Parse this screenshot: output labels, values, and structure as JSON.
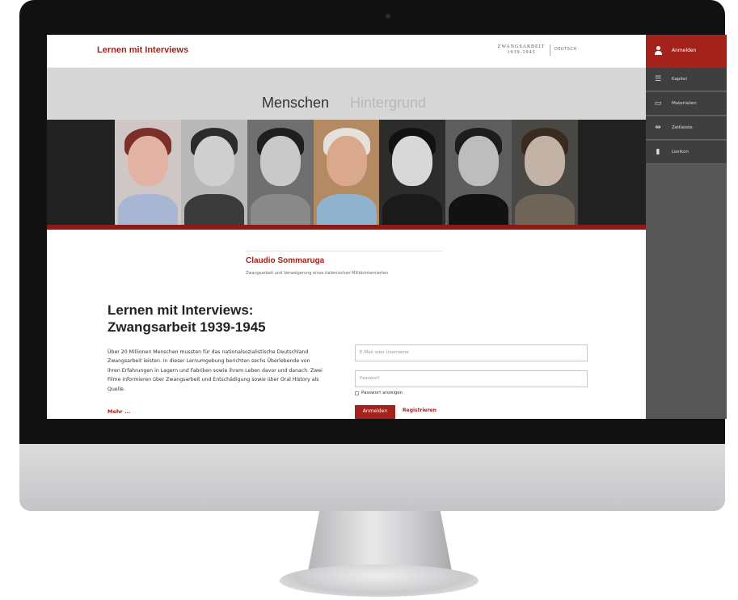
{
  "site": {
    "title": "Lernen mit Interviews",
    "brand": "ZWANGSARBEIT 1939-1945",
    "brand_lang": "DEUTSCH"
  },
  "tabs": [
    {
      "label": "Menschen",
      "active": true
    },
    {
      "label": "Hintergrund",
      "active": false
    }
  ],
  "person": {
    "name": "Claudio Sommaruga",
    "subtitle": "Zwangsarbeit und Verweigerung eines italienischen Militärinternierten"
  },
  "intro": {
    "heading_line1": "Lernen mit Interviews:",
    "heading_line2": "Zwangsarbeit 1939-1945",
    "text": "Über 20 Millionen Menschen mussten für das nationalsozialistische Deutschland Zwangsarbeit leisten. In dieser Lernumgebung berichten sechs Überlebende von ihren Erfahrungen in Lagern und Fabriken sowie ihrem Leben davor und danach. Zwei Filme informieren über Zwangsarbeit und Entschädigung sowie über Oral History als Quelle.",
    "more_link": "Mehr ..."
  },
  "login_form": {
    "email_placeholder": "E-Mail oder Username",
    "password_placeholder": "Passwort",
    "show_password_label": "Passwort anzeigen",
    "login_button": "Anmelden",
    "register_link": "Registrieren"
  },
  "sidebar": {
    "login_label": "Anmelden",
    "items": [
      {
        "label": "Kapitel",
        "icon": "menu-icon"
      },
      {
        "label": "Materialien",
        "icon": "folder-icon"
      },
      {
        "label": "Zeitleiste",
        "icon": "timeline-icon"
      },
      {
        "label": "Lexikon",
        "icon": "book-icon"
      }
    ]
  },
  "colors": {
    "accent": "#a3231c",
    "sidebar": "#565656",
    "tabbar": "#d7d7d7"
  }
}
